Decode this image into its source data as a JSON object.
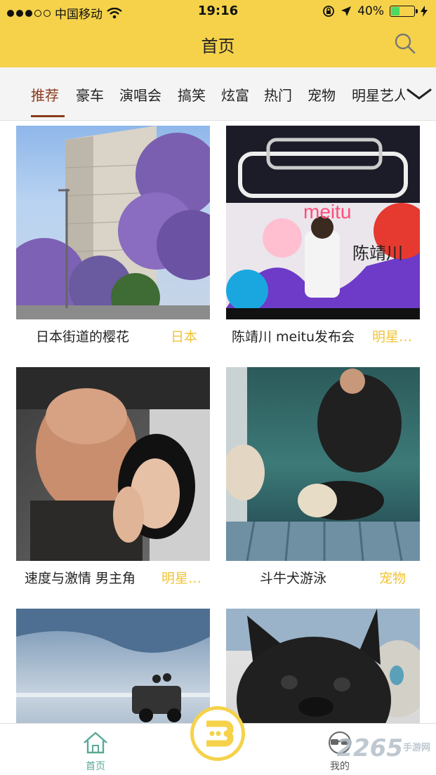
{
  "status": {
    "carrier": "中国移动",
    "time": "19:16",
    "battery": "40%",
    "battery_level": 0.4
  },
  "header": {
    "title": "首页"
  },
  "categories": [
    "推荐",
    "豪车",
    "演唱会",
    "搞笑",
    "炫富",
    "热门",
    "宠物",
    "明星艺人"
  ],
  "active_category": "推荐",
  "cards": [
    {
      "title": "日本街道的樱花",
      "tag": "日本"
    },
    {
      "title": "陈靖川 meitu发布会",
      "tag": "明星…",
      "thumb_text": "meitu",
      "thumb_text2": "陈靖川"
    },
    {
      "title": "速度与激情 男主角",
      "tag": "明星…"
    },
    {
      "title": "斗牛犬游泳",
      "tag": "宠物"
    },
    {
      "title": "",
      "tag": ""
    },
    {
      "title": "",
      "tag": ""
    }
  ],
  "tabs": {
    "home": "首页",
    "mine": "我的"
  },
  "watermark": {
    "brand": "2265",
    "sub": "手游网"
  },
  "colors": {
    "accent": "#f5d24a",
    "tag": "#f0c436",
    "active": "#8b3a1c",
    "home_tab": "#5aa896"
  }
}
